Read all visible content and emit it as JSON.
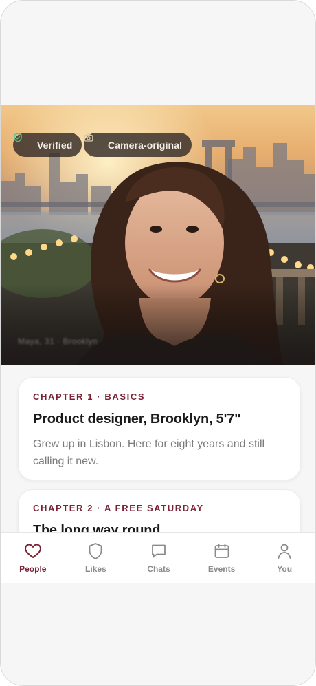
{
  "profile": {
    "badges": {
      "verified": "Verified",
      "camera": "Camera-original"
    },
    "photo_caption": "Maya, 31 · Brooklyn"
  },
  "cards": [
    {
      "chapter": "CHAPTER 1 · BASICS",
      "title": "Product designer, Brooklyn, 5'7\"",
      "body": "Grew up in Lisbon. Here for eight years and still calling it new."
    },
    {
      "chapter": "CHAPTER 2 · A FREE SATURDAY",
      "title": "The long way round"
    }
  ],
  "nav": {
    "people": "People",
    "likes": "Likes",
    "chats": "Chats",
    "events": "Events",
    "you": "You"
  },
  "colors": {
    "accent": "#7a2337",
    "muted": "#8a8a8a",
    "verified_icon": "#5bbf8a"
  }
}
